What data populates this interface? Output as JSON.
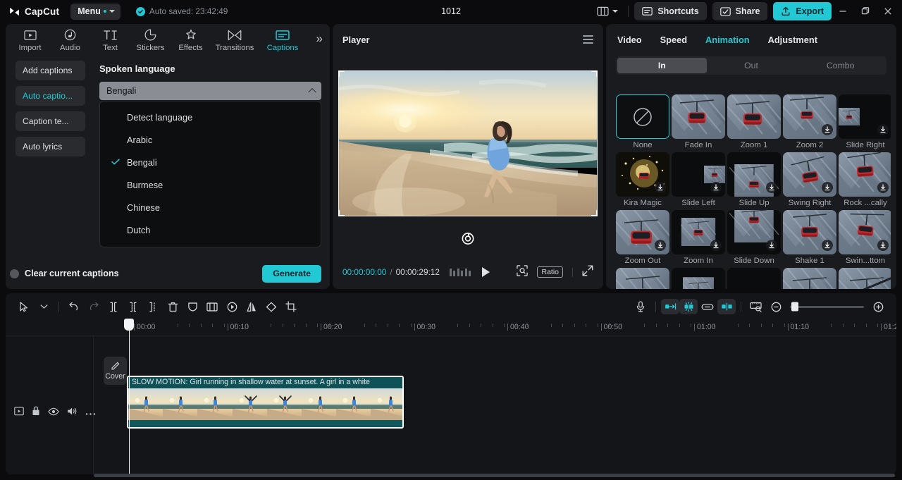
{
  "titlebar": {
    "brand": "CapCut",
    "menu_label": "Menu",
    "autosave_text": "Auto saved: 23:42:49",
    "project_title": "1012",
    "shortcuts_label": "Shortcuts",
    "share_label": "Share",
    "export_label": "Export",
    "icons": {
      "layout": "layout-grid-icon",
      "minimize": "minimize-icon",
      "maximize": "maximize-icon",
      "close": "close-icon"
    }
  },
  "left_panel": {
    "tabs": [
      {
        "label": "Import",
        "icon": "import-icon",
        "active": false
      },
      {
        "label": "Audio",
        "icon": "audio-note-icon",
        "active": false
      },
      {
        "label": "Text",
        "icon": "text-ti-icon",
        "active": false
      },
      {
        "label": "Stickers",
        "icon": "sticker-icon",
        "active": false
      },
      {
        "label": "Effects",
        "icon": "effects-sparkle-icon",
        "active": false
      },
      {
        "label": "Transitions",
        "icon": "transitions-icon",
        "active": false
      },
      {
        "label": "Captions",
        "icon": "captions-icon",
        "active": true
      }
    ],
    "more_label": "»",
    "side_items": [
      {
        "label": "Add captions",
        "active": false
      },
      {
        "label": "Auto captio...",
        "active": true
      },
      {
        "label": "Caption te...",
        "active": false
      },
      {
        "label": "Auto lyrics",
        "active": false
      }
    ],
    "section_label": "Spoken language",
    "select_value": "Bengali",
    "dropdown_options": [
      {
        "label": "Detect language",
        "checked": false
      },
      {
        "label": "Arabic",
        "checked": false
      },
      {
        "label": "Bengali",
        "checked": true
      },
      {
        "label": "Burmese",
        "checked": false
      },
      {
        "label": "Chinese",
        "checked": false
      },
      {
        "label": "Dutch",
        "checked": false
      }
    ],
    "clear_captions_label": "Clear current captions",
    "generate_label": "Generate"
  },
  "player": {
    "title": "Player",
    "current_time": "00:00:00:00",
    "time_separator": "/",
    "total_time": "00:00:29:12",
    "ratio_label": "Ratio",
    "icons": {
      "menu": "hamburger-icon",
      "rotate": "rotate-handle-icon",
      "keyframe": "keyframe-bars-icon",
      "play": "play-icon",
      "zoom_fit": "zoom-fit-icon",
      "fullscreen": "fullscreen-icon"
    }
  },
  "right_panel": {
    "tabs": [
      {
        "label": "Video",
        "active": false
      },
      {
        "label": "Speed",
        "active": false
      },
      {
        "label": "Animation",
        "active": true
      },
      {
        "label": "Adjustment",
        "active": false
      }
    ],
    "segments": [
      {
        "label": "In",
        "active": true
      },
      {
        "label": "Out",
        "active": false
      },
      {
        "label": "Combo",
        "active": false
      }
    ],
    "animations": [
      {
        "label": "None",
        "selected": true,
        "download": false,
        "style": "none"
      },
      {
        "label": "Fade In",
        "selected": false,
        "download": false,
        "style": "fade"
      },
      {
        "label": "Zoom 1",
        "selected": false,
        "download": false,
        "style": "zoom1"
      },
      {
        "label": "Zoom 2",
        "selected": false,
        "download": true,
        "style": "zoom2"
      },
      {
        "label": "Slide Right",
        "selected": false,
        "download": true,
        "style": "slideright"
      },
      {
        "label": "Kira Magic",
        "selected": false,
        "download": true,
        "style": "kira"
      },
      {
        "label": "Slide Left",
        "selected": false,
        "download": true,
        "style": "slideleft"
      },
      {
        "label": "Slide Up",
        "selected": false,
        "download": true,
        "style": "slideup"
      },
      {
        "label": "Swing Right",
        "selected": false,
        "download": true,
        "style": "swing"
      },
      {
        "label": "Rock ...cally",
        "selected": false,
        "download": true,
        "style": "rock"
      },
      {
        "label": "Zoom Out",
        "selected": false,
        "download": true,
        "style": "zoomout"
      },
      {
        "label": "Zoom In",
        "selected": false,
        "download": true,
        "style": "zoomin"
      },
      {
        "label": "Slide Down",
        "selected": false,
        "download": true,
        "style": "slidedown"
      },
      {
        "label": "Shake 1",
        "selected": false,
        "download": true,
        "style": "shake"
      },
      {
        "label": "Swin...ttom",
        "selected": false,
        "download": true,
        "style": "swingbottom"
      },
      {
        "label": "",
        "selected": false,
        "download": false,
        "style": "r4a"
      },
      {
        "label": "",
        "selected": false,
        "download": false,
        "style": "r4b"
      },
      {
        "label": "",
        "selected": false,
        "download": false,
        "style": "r4c"
      },
      {
        "label": "",
        "selected": false,
        "download": false,
        "style": "r4d"
      },
      {
        "label": "",
        "selected": false,
        "download": false,
        "style": "r4e"
      }
    ]
  },
  "timeline": {
    "toolbar_left_icons": [
      "select-arrow-icon",
      "chevron-down-icon",
      "undo-icon",
      "redo-icon",
      "split-icon",
      "split-center-icon",
      "split-right-icon",
      "delete-icon",
      "mask-icon",
      "crop-frames-icon",
      "freeze-icon",
      "mirror-icon",
      "rotate-icon",
      "crop-icon"
    ],
    "toolbar_right_icons": [
      "microphone-icon",
      "auto-cut-icon",
      "stabilize-icon",
      "link-icon",
      "align-icon",
      "preview-ruler-icon",
      "zoom-out-icon",
      "zoom-slider",
      "zoom-in-icon"
    ],
    "ruler_labels": [
      "00:00",
      "00:10",
      "00:20",
      "00:30",
      "00:40",
      "00:50",
      "01:00",
      "01:10",
      "01:2"
    ],
    "track_head_icons": [
      "track-thumbnail-icon",
      "lock-icon",
      "eye-icon",
      "volume-icon",
      "more-icon"
    ],
    "cover_label": "Cover",
    "clip_title": "SLOW MOTION: Girl running in shallow water at sunset. A girl in a white"
  }
}
